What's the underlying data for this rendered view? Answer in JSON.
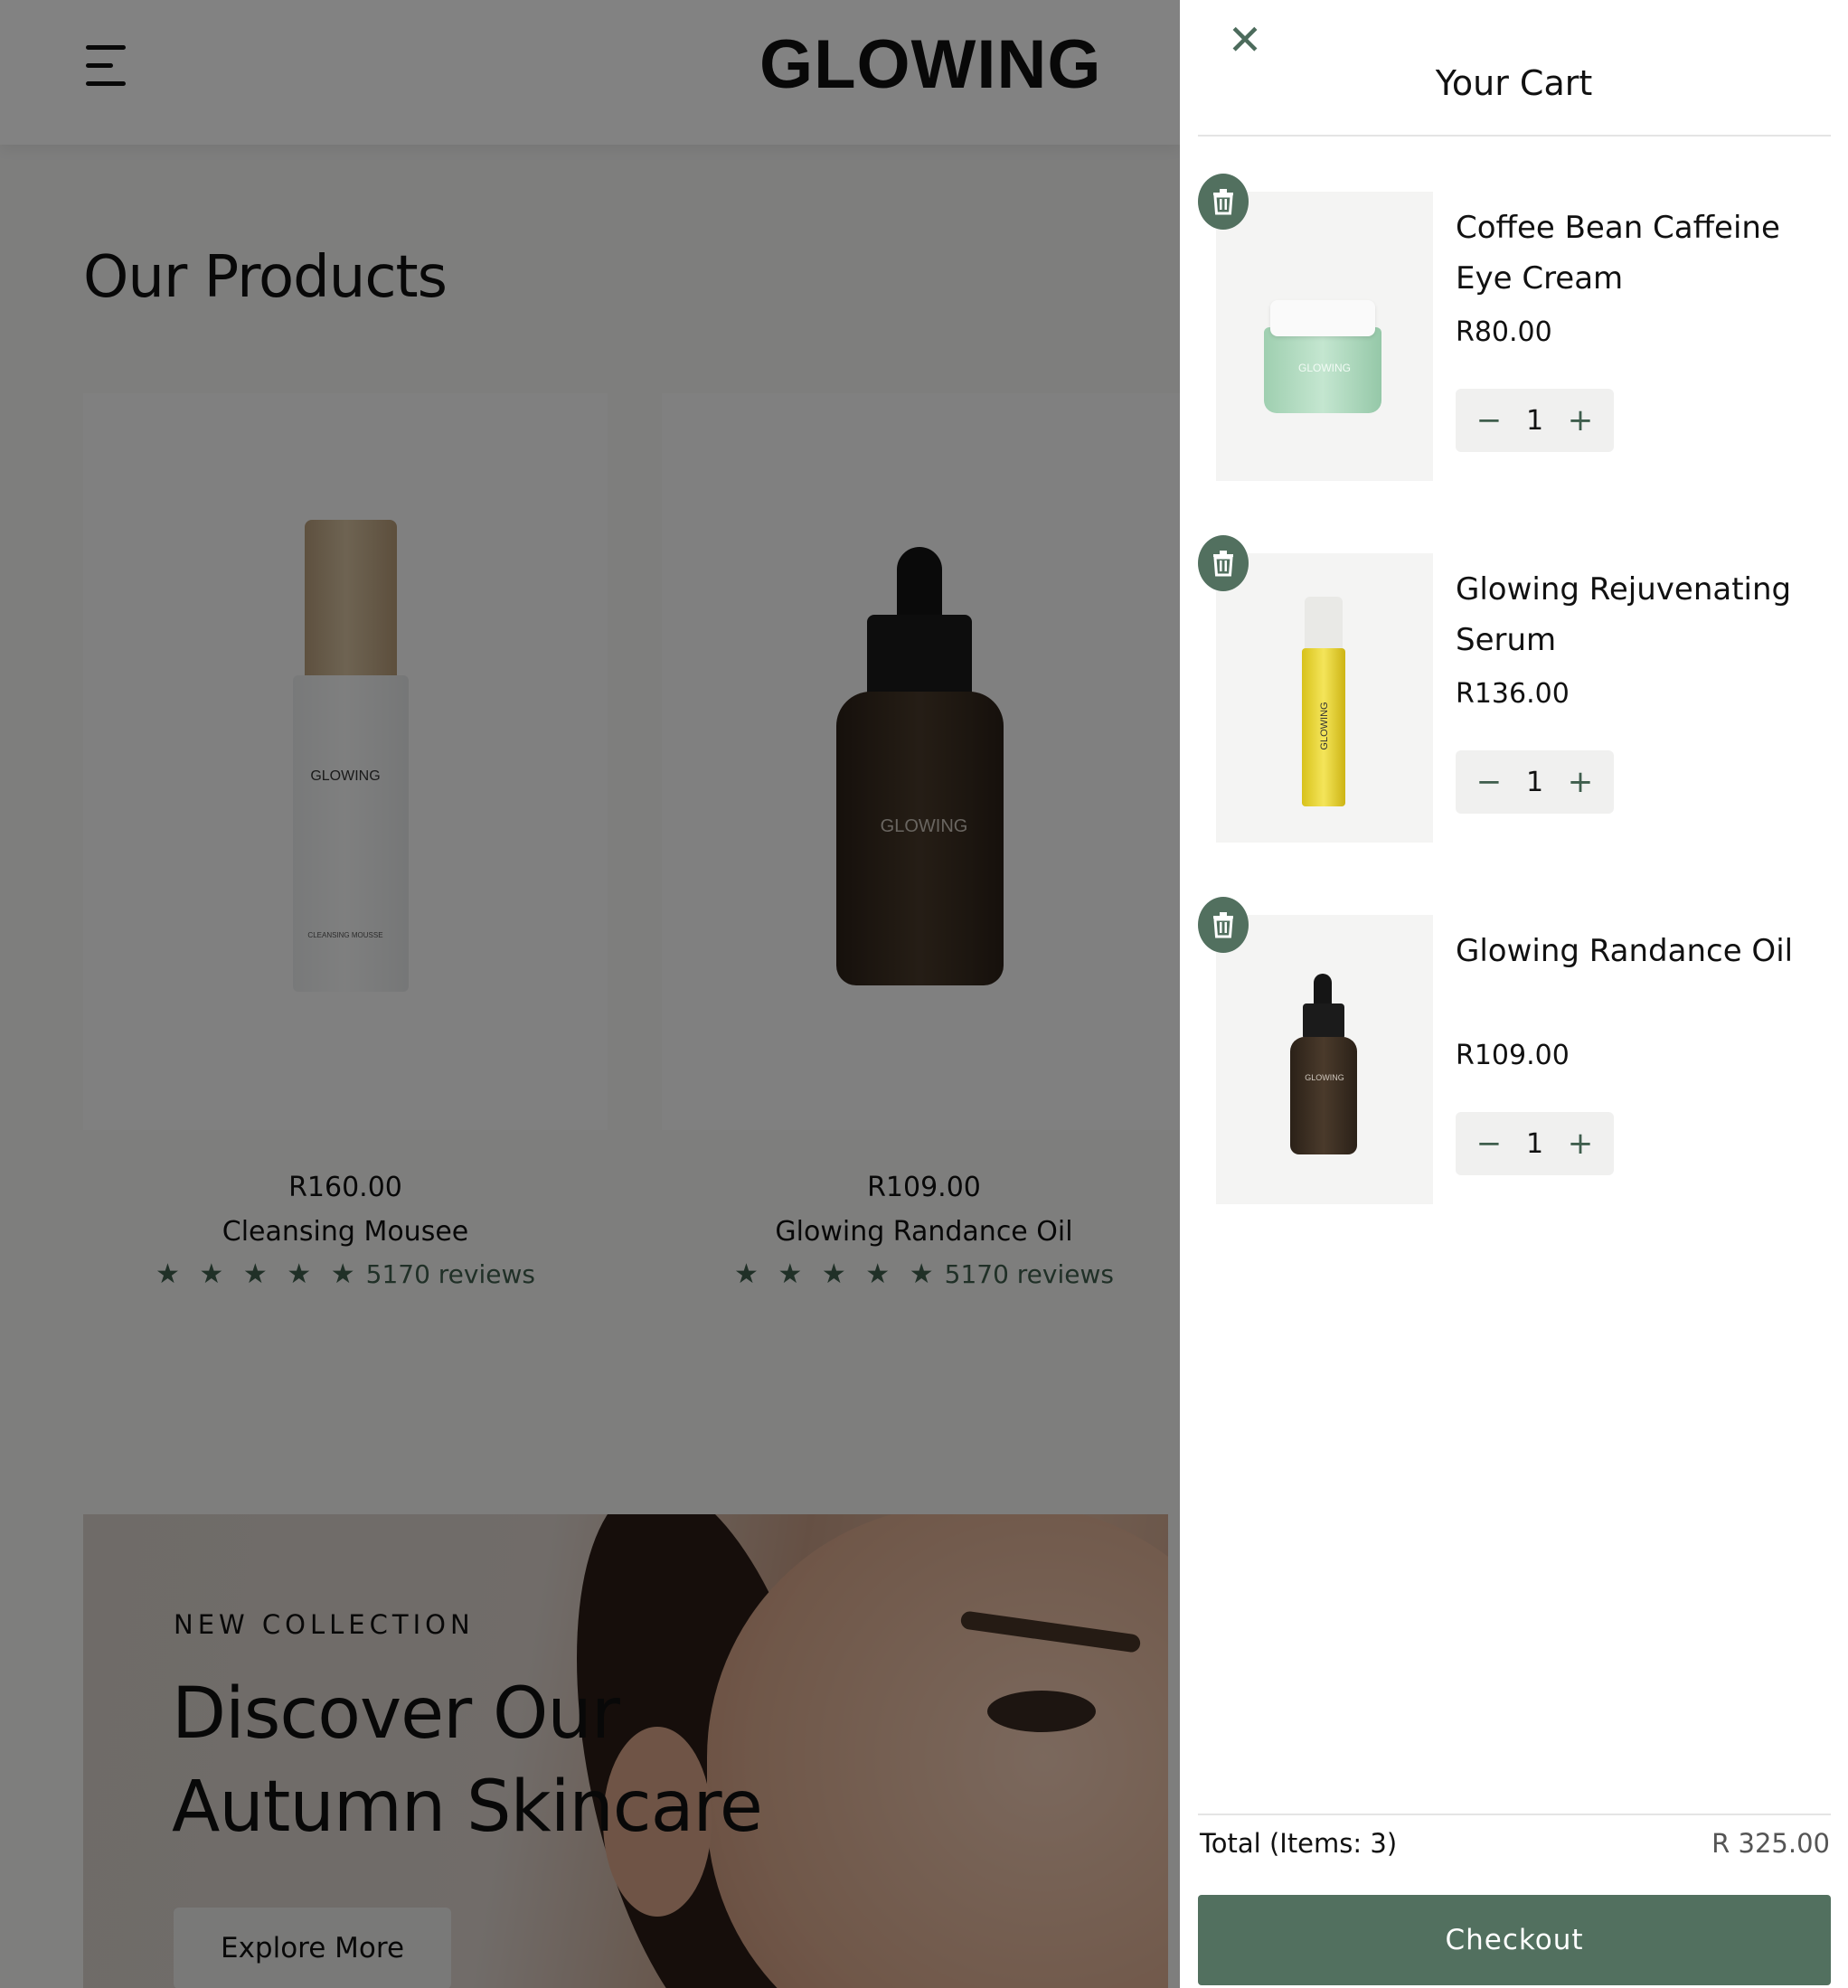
{
  "header": {
    "logo": "GLOWING"
  },
  "products": {
    "title": "Our Products",
    "items": [
      {
        "price": "R160.00",
        "name": "Cleansing Mousee",
        "stars": "★ ★ ★ ★ ★",
        "reviews": "5170 reviews",
        "label": "GLOWING",
        "sub_label": "CLEANSING MOUSSE"
      },
      {
        "price": "R109.00",
        "name": "Glowing Randance Oil",
        "stars": "★ ★ ★ ★ ★",
        "reviews": "5170 reviews",
        "label": "GLOWING"
      }
    ]
  },
  "banner": {
    "kicker": "NEW COLLECTION",
    "headline": "Discover Our Autumn Skincare",
    "button": "Explore More"
  },
  "cart": {
    "title": "Your Cart",
    "items": [
      {
        "name": "Coffee Bean Caffeine Eye Cream",
        "price": "R80.00",
        "qty": "1",
        "thumb_label": "GLOWING"
      },
      {
        "name": "Glowing Rejuvenating Serum",
        "price": "R136.00",
        "qty": "1",
        "thumb_label": "GLOWING"
      },
      {
        "name": "Glowing Randance Oil",
        "price": "R109.00",
        "qty": "1",
        "thumb_label": "GLOWING"
      }
    ],
    "stepper": {
      "minus": "−",
      "plus": "+"
    },
    "total_label": "Total (Items: 3)",
    "total_value": "R 325.00",
    "checkout": "Checkout"
  },
  "icons": {
    "menu": "hamburger-menu-icon",
    "close": "close-icon",
    "trash": "trash-icon",
    "star": "star-icon"
  },
  "colors": {
    "accent": "#52705f",
    "accent_text": "#3f5e4d",
    "overlay": "rgba(0,0,0,0.49)"
  }
}
